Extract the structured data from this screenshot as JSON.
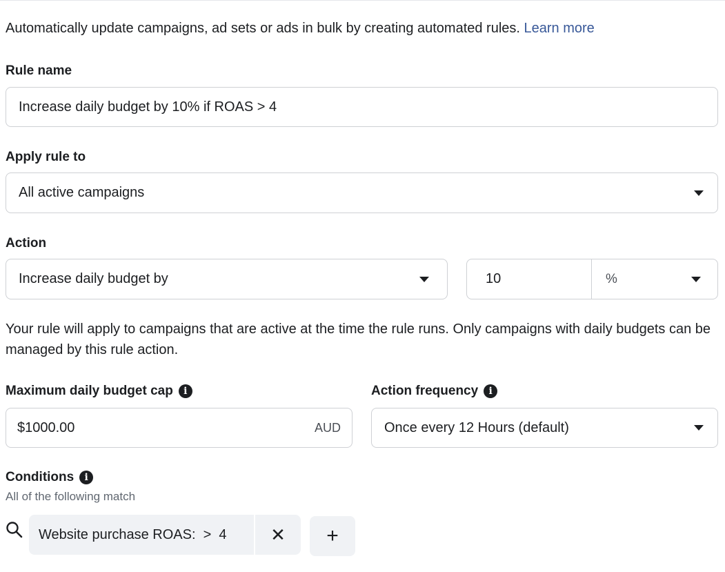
{
  "intro": {
    "text": "Automatically update campaigns, ad sets or ads in bulk by creating automated rules.",
    "learn_more": "Learn more"
  },
  "rule_name": {
    "label": "Rule name",
    "value": "Increase daily budget by 10% if ROAS > 4"
  },
  "apply_rule": {
    "label": "Apply rule to",
    "selected": "All active campaigns"
  },
  "action": {
    "label": "Action",
    "selected": "Increase daily budget by",
    "amount": "10",
    "unit": "%"
  },
  "helper_text": "Your rule will apply to campaigns that are active at the time the rule runs. Only campaigns with daily budgets can be managed by this rule action.",
  "budget_cap": {
    "label": "Maximum daily budget cap",
    "value": "$1000.00",
    "currency": "AUD"
  },
  "frequency": {
    "label": "Action frequency",
    "selected": "Once every 12 Hours (default)"
  },
  "conditions": {
    "label": "Conditions",
    "subtitle": "All of the following match",
    "chip": "Website purchase ROAS:  >  4",
    "remove": "✕",
    "add": "+"
  },
  "icons": {
    "info": "info-icon",
    "dropdown": "caret-down-icon",
    "search": "search-icon"
  }
}
